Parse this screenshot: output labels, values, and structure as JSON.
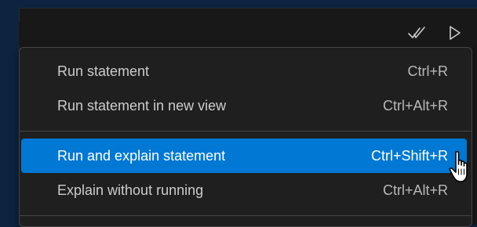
{
  "toolbar": {
    "icons": [
      {
        "name": "explain-icon",
        "kind": "double-check"
      },
      {
        "name": "run-icon",
        "kind": "play-triangle"
      }
    ]
  },
  "menu": {
    "groups": [
      [
        {
          "label": "Run statement",
          "shortcut": "Ctrl+R",
          "selected": false
        },
        {
          "label": "Run statement in new view",
          "shortcut": "Ctrl+Alt+R",
          "selected": false
        }
      ],
      [
        {
          "label": "Run and explain statement",
          "shortcut": "Ctrl+Shift+R",
          "selected": true
        },
        {
          "label": "Explain without running",
          "shortcut": "Ctrl+Alt+R",
          "selected": false
        }
      ]
    ]
  },
  "colors": {
    "desktop": "#0c2440",
    "editor": "#181818",
    "menu": "#1f1f1f",
    "border": "#454545",
    "selection": "#0078d4",
    "text": "#cccccc"
  },
  "pointer": "hand-pointer-icon"
}
